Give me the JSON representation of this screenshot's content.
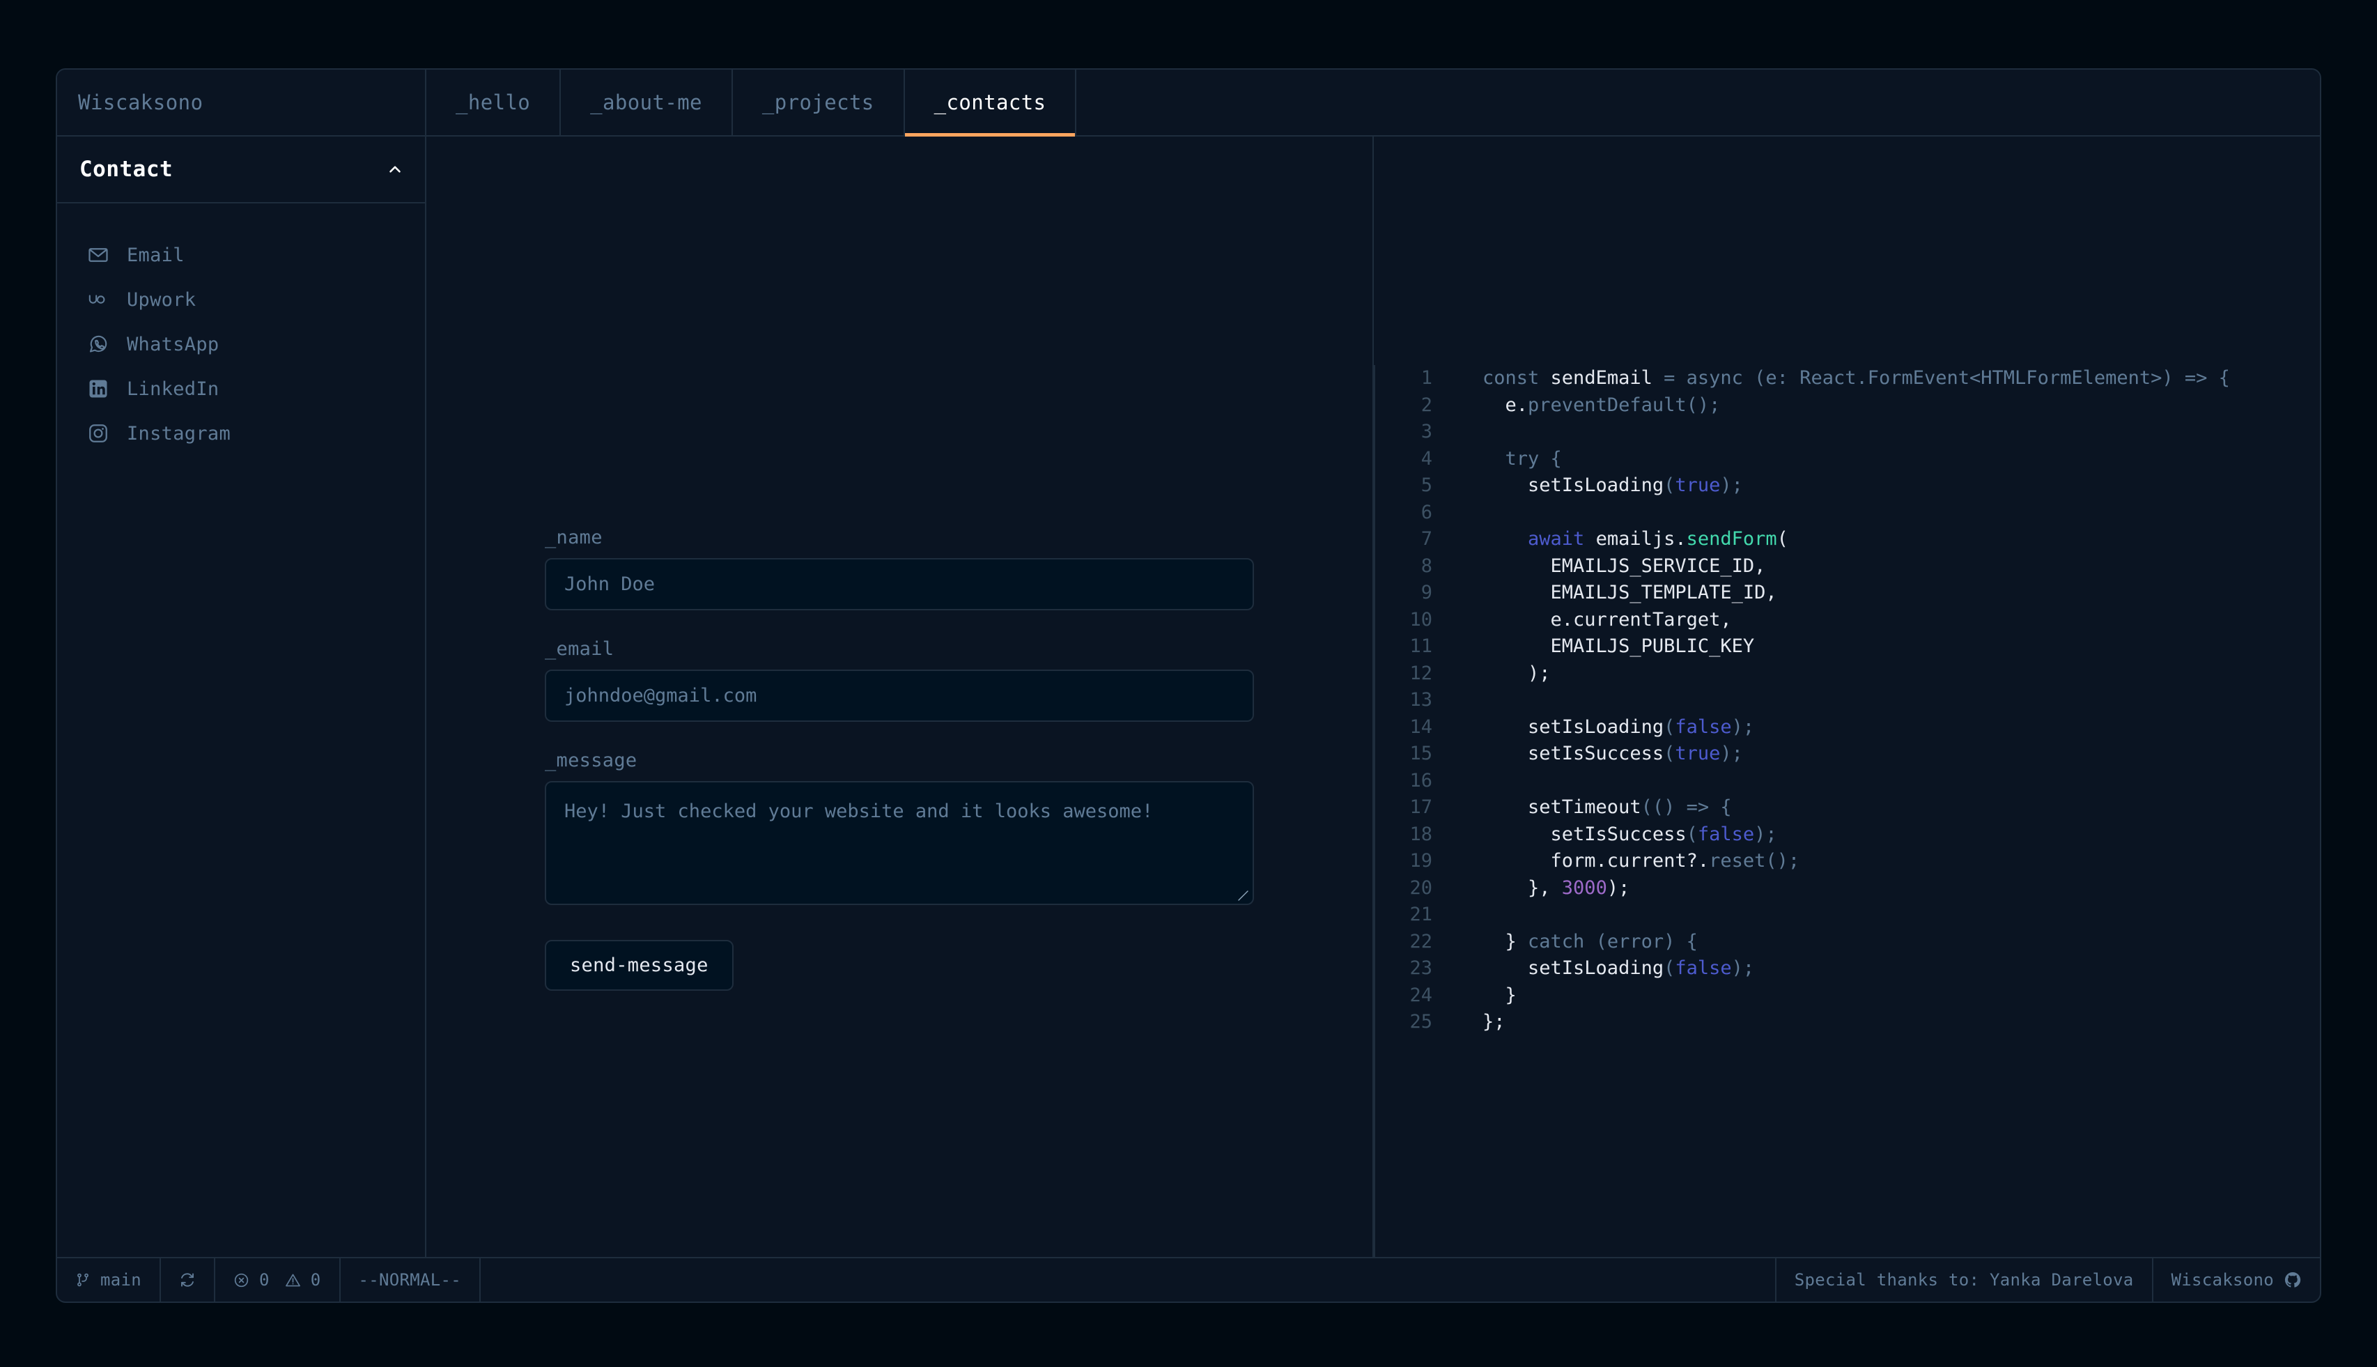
{
  "header": {
    "brand": "Wiscaksono",
    "tabs": [
      {
        "label": "_hello",
        "active": false
      },
      {
        "label": "_about-me",
        "active": false
      },
      {
        "label": "_projects",
        "active": false
      },
      {
        "label": "_contacts",
        "active": true
      }
    ]
  },
  "sidebar": {
    "section_title": "Contact",
    "collapse_icon": "chevron-up-icon",
    "items": [
      {
        "label": "Email",
        "icon": "envelope-icon"
      },
      {
        "label": "Upwork",
        "icon": "upwork-icon"
      },
      {
        "label": "WhatsApp",
        "icon": "whatsapp-icon"
      },
      {
        "label": "LinkedIn",
        "icon": "linkedin-icon"
      },
      {
        "label": "Instagram",
        "icon": "instagram-icon"
      }
    ]
  },
  "form": {
    "name_label": "_name",
    "name_value": "John Doe",
    "name_placeholder": "John Doe",
    "email_label": "_email",
    "email_value": "johndoe@gmail.com",
    "email_placeholder": "johndoe@gmail.com",
    "message_label": "_message",
    "message_value": "Hey! Just checked your website and it looks awesome!",
    "message_placeholder": "Hey! Just checked your website and it looks awesome!",
    "submit_label": "send-message"
  },
  "code": {
    "lines": [
      {
        "n": "1",
        "tokens": [
          {
            "t": "const ",
            "c": "dim"
          },
          {
            "t": "sendEmail ",
            "c": "id"
          },
          {
            "t": "= ",
            "c": "dim"
          },
          {
            "t": "async ",
            "c": "dim"
          },
          {
            "t": "(e: ",
            "c": "dim"
          },
          {
            "t": "React.FormEvent<HTMLFormElement>",
            "c": "dim"
          },
          {
            "t": ") => {",
            "c": "dim"
          }
        ]
      },
      {
        "n": "2",
        "tokens": [
          {
            "t": "  e.",
            "c": "id"
          },
          {
            "t": "preventDefault();",
            "c": "dim"
          }
        ]
      },
      {
        "n": "3",
        "tokens": []
      },
      {
        "n": "4",
        "tokens": [
          {
            "t": "  try {",
            "c": "dim"
          }
        ]
      },
      {
        "n": "5",
        "tokens": [
          {
            "t": "    setIsLoading",
            "c": "id"
          },
          {
            "t": "(",
            "c": "dim"
          },
          {
            "t": "true",
            "c": "bool"
          },
          {
            "t": ");",
            "c": "dim"
          }
        ]
      },
      {
        "n": "6",
        "tokens": []
      },
      {
        "n": "7",
        "tokens": [
          {
            "t": "    await ",
            "c": "kw"
          },
          {
            "t": "emailjs.",
            "c": "id"
          },
          {
            "t": "sendForm",
            "c": "fn"
          },
          {
            "t": "(",
            "c": "id"
          }
        ]
      },
      {
        "n": "8",
        "tokens": [
          {
            "t": "      EMAILJS_SERVICE_ID,",
            "c": "id"
          }
        ]
      },
      {
        "n": "9",
        "tokens": [
          {
            "t": "      EMAILJS_TEMPLATE_ID,",
            "c": "id"
          }
        ]
      },
      {
        "n": "10",
        "tokens": [
          {
            "t": "      e.currentTarget,",
            "c": "id"
          }
        ]
      },
      {
        "n": "11",
        "tokens": [
          {
            "t": "      EMAILJS_PUBLIC_KEY",
            "c": "id"
          }
        ]
      },
      {
        "n": "12",
        "tokens": [
          {
            "t": "    );",
            "c": "id"
          }
        ]
      },
      {
        "n": "13",
        "tokens": []
      },
      {
        "n": "14",
        "tokens": [
          {
            "t": "    setIsLoading",
            "c": "id"
          },
          {
            "t": "(",
            "c": "dim"
          },
          {
            "t": "false",
            "c": "bool"
          },
          {
            "t": ");",
            "c": "dim"
          }
        ]
      },
      {
        "n": "15",
        "tokens": [
          {
            "t": "    setIsSuccess",
            "c": "id"
          },
          {
            "t": "(",
            "c": "dim"
          },
          {
            "t": "true",
            "c": "bool"
          },
          {
            "t": ");",
            "c": "dim"
          }
        ]
      },
      {
        "n": "16",
        "tokens": []
      },
      {
        "n": "17",
        "tokens": [
          {
            "t": "    setTimeout",
            "c": "id"
          },
          {
            "t": "(() => {",
            "c": "dim"
          }
        ]
      },
      {
        "n": "18",
        "tokens": [
          {
            "t": "      setIsSuccess",
            "c": "id"
          },
          {
            "t": "(",
            "c": "dim"
          },
          {
            "t": "false",
            "c": "bool"
          },
          {
            "t": ");",
            "c": "dim"
          }
        ]
      },
      {
        "n": "19",
        "tokens": [
          {
            "t": "      form.current?.",
            "c": "id"
          },
          {
            "t": "reset();",
            "c": "dim"
          }
        ]
      },
      {
        "n": "20",
        "tokens": [
          {
            "t": "    }, ",
            "c": "id"
          },
          {
            "t": "3000",
            "c": "num"
          },
          {
            "t": ");",
            "c": "id"
          }
        ]
      },
      {
        "n": "21",
        "tokens": []
      },
      {
        "n": "22",
        "tokens": [
          {
            "t": "  } ",
            "c": "id"
          },
          {
            "t": "catch (error) {",
            "c": "dim"
          }
        ]
      },
      {
        "n": "23",
        "tokens": [
          {
            "t": "    setIsLoading",
            "c": "id"
          },
          {
            "t": "(",
            "c": "dim"
          },
          {
            "t": "false",
            "c": "bool"
          },
          {
            "t": ");",
            "c": "dim"
          }
        ]
      },
      {
        "n": "24",
        "tokens": [
          {
            "t": "  }",
            "c": "id"
          }
        ]
      },
      {
        "n": "25",
        "tokens": [
          {
            "t": "};",
            "c": "id"
          }
        ]
      }
    ]
  },
  "status_bar": {
    "branch": "main",
    "branch_icon": "git-branch-icon",
    "sync_icon": "sync-icon",
    "error_icon": "error-circle-icon",
    "error_count": "0",
    "warning_icon": "warning-triangle-icon",
    "warning_count": "0",
    "mode": "--NORMAL--",
    "credit": "Special thanks to: Yanka Darelova",
    "author": "Wiscaksono",
    "author_icon": "github-icon"
  },
  "colors": {
    "page_bg": "#010A12",
    "window_bg": "#0A1422",
    "border": "#1E2D3D",
    "accent": "#FEA55F",
    "text_muted": "#607B96",
    "text_bright": "#E5E9F0",
    "input_bg": "#011221"
  }
}
